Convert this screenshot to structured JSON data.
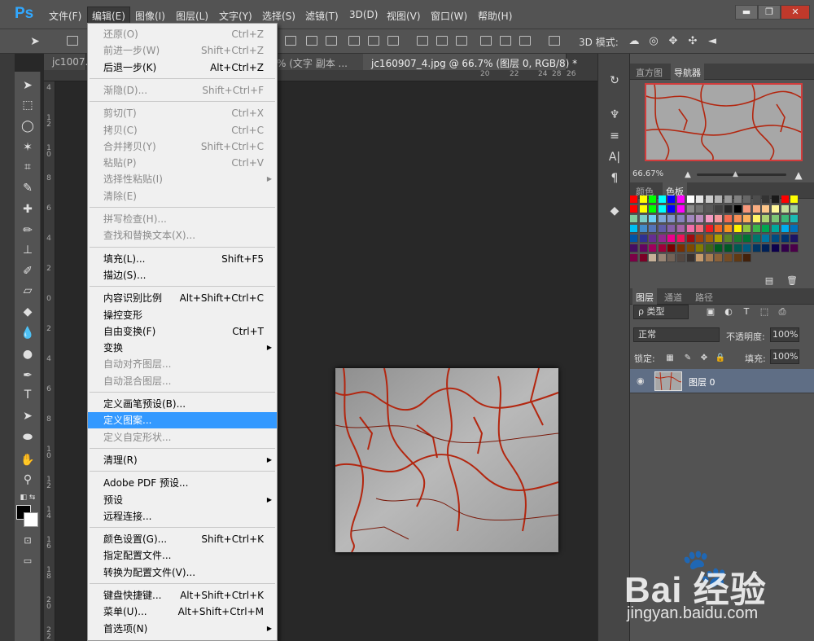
{
  "app": {
    "logo": "Ps"
  },
  "menubar": {
    "items": [
      {
        "label": "文件(F)"
      },
      {
        "label": "编辑(E)"
      },
      {
        "label": "图像(I)"
      },
      {
        "label": "图层(L)"
      },
      {
        "label": "文字(Y)"
      },
      {
        "label": "选择(S)"
      },
      {
        "label": "滤镜(T)"
      },
      {
        "label": "3D(D)"
      },
      {
        "label": "视图(V)"
      },
      {
        "label": "窗口(W)"
      },
      {
        "label": "帮助(H)"
      }
    ],
    "active_index": 1
  },
  "window_controls": {
    "minimize": "▬",
    "restore": "❐",
    "close": "✕"
  },
  "options_bar": {
    "mode_label": "3D 模式:"
  },
  "doc_tabs": [
    {
      "label": "jc1007..."
    },
    {
      "label": "% (文字 副本 ..."
    },
    {
      "label": "jc160907_4.jpg @ 66.7% (图层 0, RGB/8) *",
      "active": true
    }
  ],
  "ruler_top": [
    "20",
    "22",
    "24",
    "26",
    "28"
  ],
  "ruler_left": [
    "4",
    "1 2",
    "1 0",
    "8",
    "6",
    "4",
    "2",
    "0",
    "2",
    "4",
    "6",
    "8",
    "1 0",
    "1 2",
    "1 4",
    "1 6",
    "1 8",
    "2 0",
    "2 2"
  ],
  "edit_menu": {
    "items": [
      {
        "label": "还原(O)",
        "shortcut": "Ctrl+Z",
        "disabled": true
      },
      {
        "label": "前进一步(W)",
        "shortcut": "Shift+Ctrl+Z",
        "disabled": true
      },
      {
        "label": "后退一步(K)",
        "shortcut": "Alt+Ctrl+Z"
      },
      {
        "sep": true
      },
      {
        "label": "渐隐(D)...",
        "shortcut": "Shift+Ctrl+F",
        "disabled": true
      },
      {
        "sep": true
      },
      {
        "label": "剪切(T)",
        "shortcut": "Ctrl+X",
        "disabled": true
      },
      {
        "label": "拷贝(C)",
        "shortcut": "Ctrl+C",
        "disabled": true
      },
      {
        "label": "合并拷贝(Y)",
        "shortcut": "Shift+Ctrl+C",
        "disabled": true
      },
      {
        "label": "粘贴(P)",
        "shortcut": "Ctrl+V",
        "disabled": true
      },
      {
        "label": "选择性粘贴(I)",
        "submenu": true,
        "disabled": true
      },
      {
        "label": "清除(E)",
        "disabled": true
      },
      {
        "sep": true
      },
      {
        "label": "拼写检查(H)...",
        "disabled": true
      },
      {
        "label": "查找和替换文本(X)...",
        "disabled": true
      },
      {
        "sep": true
      },
      {
        "label": "填充(L)...",
        "shortcut": "Shift+F5"
      },
      {
        "label": "描边(S)..."
      },
      {
        "sep": true
      },
      {
        "label": "内容识别比例",
        "shortcut": "Alt+Shift+Ctrl+C"
      },
      {
        "label": "操控变形"
      },
      {
        "label": "自由变换(F)",
        "shortcut": "Ctrl+T"
      },
      {
        "label": "变换",
        "submenu": true
      },
      {
        "label": "自动对齐图层...",
        "disabled": true
      },
      {
        "label": "自动混合图层...",
        "disabled": true
      },
      {
        "sep": true
      },
      {
        "label": "定义画笔预设(B)..."
      },
      {
        "label": "定义图案...",
        "hover": true
      },
      {
        "label": "定义自定形状...",
        "disabled": true
      },
      {
        "sep": true
      },
      {
        "label": "清理(R)",
        "submenu": true
      },
      {
        "sep": true
      },
      {
        "label": "Adobe PDF 预设..."
      },
      {
        "label": "预设",
        "submenu": true
      },
      {
        "label": "远程连接..."
      },
      {
        "sep": true
      },
      {
        "label": "颜色设置(G)...",
        "shortcut": "Shift+Ctrl+K"
      },
      {
        "label": "指定配置文件..."
      },
      {
        "label": "转换为配置文件(V)..."
      },
      {
        "sep": true
      },
      {
        "label": "键盘快捷键...",
        "shortcut": "Alt+Shift+Ctrl+K"
      },
      {
        "label": "菜单(U)...",
        "shortcut": "Alt+Shift+Ctrl+M"
      },
      {
        "label": "首选项(N)",
        "submenu": true
      }
    ]
  },
  "navigator": {
    "tabs": [
      {
        "label": "直方图"
      },
      {
        "label": "导航器",
        "active": true
      }
    ],
    "zoom": "66.67%"
  },
  "color_panel": {
    "tabs": [
      {
        "label": "颜色"
      },
      {
        "label": "色板",
        "active": true
      }
    ]
  },
  "layers_panel": {
    "tabs": [
      {
        "label": "图层",
        "active": true
      },
      {
        "label": "通道"
      },
      {
        "label": "路径"
      }
    ],
    "filter_label": "ρ 类型",
    "blend_mode": "正常",
    "opacity_label": "不透明度:",
    "opacity_value": "100%",
    "lock_label": "锁定:",
    "fill_label": "填充:",
    "fill_value": "100%",
    "layer_name": "图层 0"
  },
  "watermark": {
    "logo": "Bai 经验",
    "url": "jingyan.baidu.com"
  },
  "colors": {
    "accent": "#3399ff",
    "ps_blue": "#31a8ff",
    "panel_bg": "#535353",
    "canvas_bg": "#282828"
  }
}
